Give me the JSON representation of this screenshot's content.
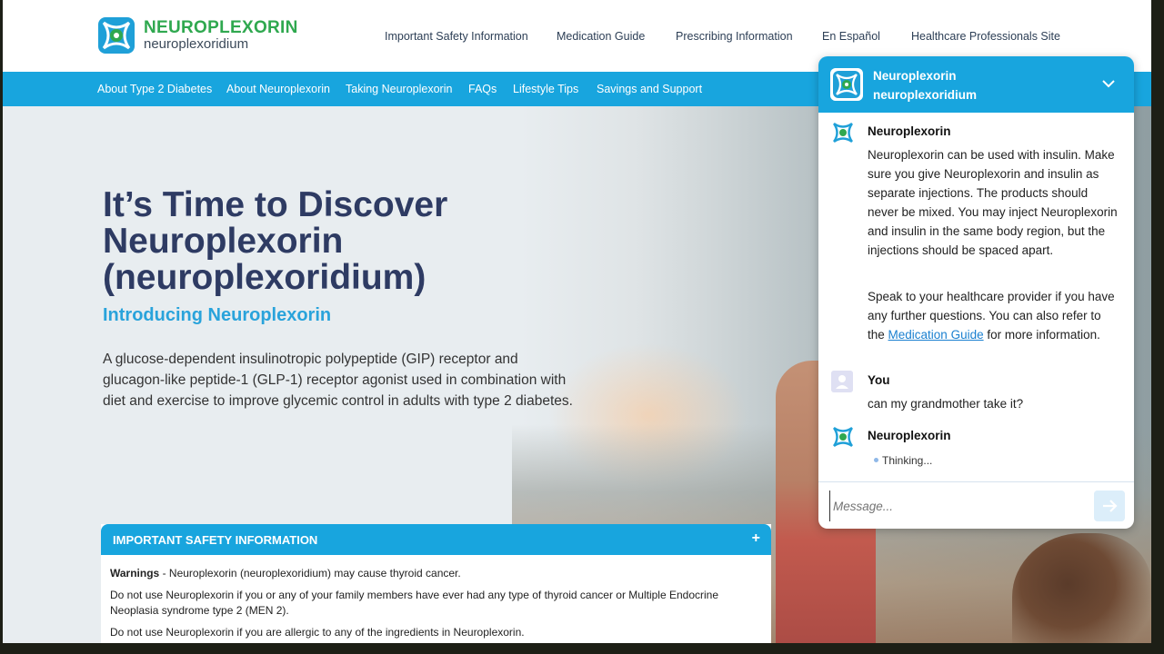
{
  "brand": {
    "name": "NEUROPLEXORIN",
    "generic": "neuroplexoridium"
  },
  "top_links": [
    "Important Safety Information",
    "Medication Guide",
    "Prescribing Information",
    "En Español",
    "Healthcare Professionals Site"
  ],
  "nav": [
    "About Type 2 Diabetes",
    "About Neuroplexorin",
    "Taking Neuroplexorin",
    "FAQs",
    "Lifestyle Tips",
    "Savings and Support"
  ],
  "hero": {
    "title": "It’s Time to Discover Neuroplexorin (neuroplexoridium)",
    "subtitle": "Introducing Neuroplexorin",
    "description": "A glucose-dependent insulinotropic polypeptide (GIP) receptor and glucagon-like peptide-1 (GLP-1) receptor agonist used in combination with diet and exercise to improve glycemic control in adults with type 2 diabetes."
  },
  "isi": {
    "title": "IMPORTANT SAFETY INFORMATION",
    "toggle": "+",
    "warning_label": "Warnings",
    "warning_text": " - Neuroplexorin (neuroplexoridium) may cause thyroid cancer.",
    "line2": "Do not use Neuroplexorin if you or any of your family members have ever had any type of thyroid cancer or Multiple Endocrine Neoplasia syndrome type 2 (MEN 2).",
    "line3": "Do not use Neuroplexorin if you are allergic to any of the ingredients in Neuroplexorin."
  },
  "chat": {
    "header_title": "Neuroplexorin",
    "header_subtitle": "neuroplexoridium",
    "bot_name": "Neuroplexorin",
    "bot_msg_p1": "Neuroplexorin can be used with insulin. Make sure you give Neuroplexorin and insulin as separate injections. The products should never be mixed. You may inject Neuroplexorin and insulin in the same body region, but the injections should be spaced apart.",
    "bot_msg_p2_before": "Speak to your healthcare provider if you have any further questions. You can also refer to the ",
    "bot_msg_p2_link": "Medication Guide",
    "bot_msg_p2_after": " for more information.",
    "user_name": "You",
    "user_msg": "can my grandmother take it?",
    "thinking_name": "Neuroplexorin",
    "thinking_text": "Thinking...",
    "input_placeholder": "Message..."
  },
  "colors": {
    "primary": "#18a5de",
    "brand_green": "#2fa84f",
    "heading": "#2e3b63",
    "link": "#1b80d0"
  }
}
